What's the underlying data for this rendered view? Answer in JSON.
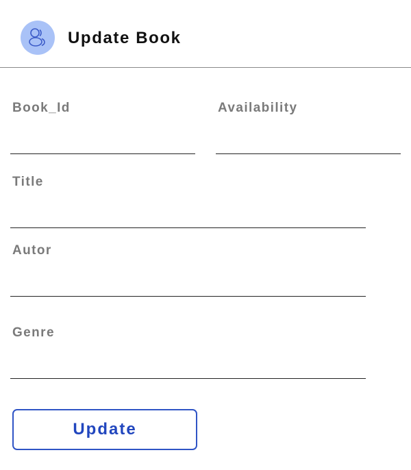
{
  "header": {
    "title": "Update Book",
    "icon": "users-icon",
    "avatar_color": "#a9c2f7",
    "icon_color": "#3b5bc8"
  },
  "form": {
    "fields": {
      "book_id": {
        "label": "Book_Id",
        "value": "",
        "placeholder": ""
      },
      "availability": {
        "label": "Availability",
        "value": "",
        "placeholder": ""
      },
      "title": {
        "label": "Title",
        "value": "",
        "placeholder": ""
      },
      "autor": {
        "label": "Autor",
        "value": "",
        "placeholder": ""
      },
      "genre": {
        "label": "Genre",
        "value": "",
        "placeholder": ""
      }
    },
    "submit_label": "Update",
    "accent_color": "#2f54c5"
  }
}
